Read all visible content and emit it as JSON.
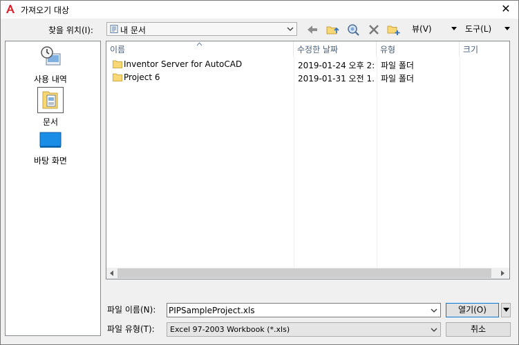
{
  "window": {
    "title": "가져오기 대상",
    "close_glyph": "✕"
  },
  "toolbar": {
    "look_in_label": "찾을 위치(I):",
    "look_in_value": "내 문서",
    "view_label": "뷰(V)",
    "tools_label": "도구(L)"
  },
  "places": [
    {
      "label": "사용 내역"
    },
    {
      "label": "문서"
    },
    {
      "label": "바탕 화면"
    }
  ],
  "file_list": {
    "columns": [
      "이름",
      "수정한 날짜",
      "유형",
      "크기"
    ],
    "rows": [
      {
        "name": "Inventor Server for AutoCAD",
        "date": "2019-01-24 오후 2:...",
        "type": "파일 폴더",
        "size": ""
      },
      {
        "name": "Project 6",
        "date": "2019-01-31 오전 1...",
        "type": "파일 폴더",
        "size": ""
      }
    ]
  },
  "bottom": {
    "file_name_label": "파일 이름(N):",
    "file_name_value": "PIPSampleProject.xls",
    "file_type_label": "파일 유형(T):",
    "file_type_value": "Excel 97-2003 Workbook (*.xls)",
    "open_label": "열기(O)",
    "cancel_label": "취소"
  },
  "colors": {
    "accent": "#0078d7",
    "app_icon": "#d6202a",
    "folder": "#f8d775"
  }
}
